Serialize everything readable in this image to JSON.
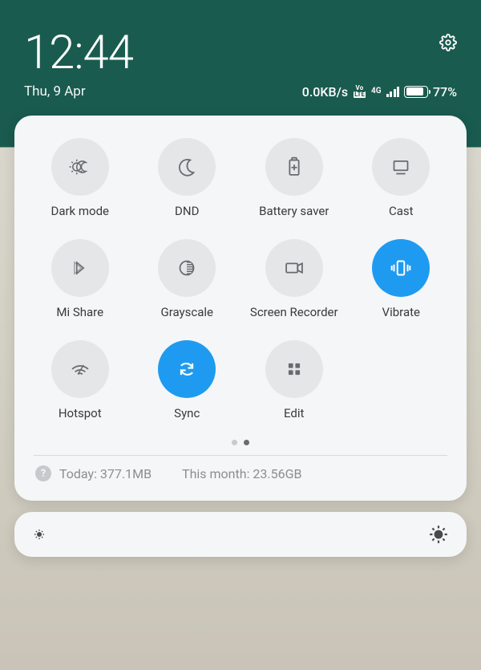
{
  "status": {
    "time": "12:44",
    "date": "Thu, 9 Apr",
    "data_speed": "0.0KB/s",
    "network_type": "4G",
    "volte_top": "Vo",
    "volte_bot": "LTE",
    "battery_percent": "77%"
  },
  "tiles": [
    {
      "id": "dark-mode",
      "label": "Dark mode",
      "active": false
    },
    {
      "id": "dnd",
      "label": "DND",
      "active": false
    },
    {
      "id": "battery-saver",
      "label": "Battery saver",
      "active": false
    },
    {
      "id": "cast",
      "label": "Cast",
      "active": false
    },
    {
      "id": "mi-share",
      "label": "Mi Share",
      "active": false
    },
    {
      "id": "grayscale",
      "label": "Grayscale",
      "active": false
    },
    {
      "id": "screen-recorder",
      "label": "Screen Recorder",
      "active": false
    },
    {
      "id": "vibrate",
      "label": "Vibrate",
      "active": true
    },
    {
      "id": "hotspot",
      "label": "Hotspot",
      "active": false
    },
    {
      "id": "sync",
      "label": "Sync",
      "active": true
    },
    {
      "id": "edit",
      "label": "Edit",
      "active": false
    }
  ],
  "pager": {
    "count": 2,
    "active": 1
  },
  "usage": {
    "today_prefix": "Today: ",
    "today_value": "377.1MB",
    "month_prefix": "This month: ",
    "month_value": "23.56GB"
  }
}
